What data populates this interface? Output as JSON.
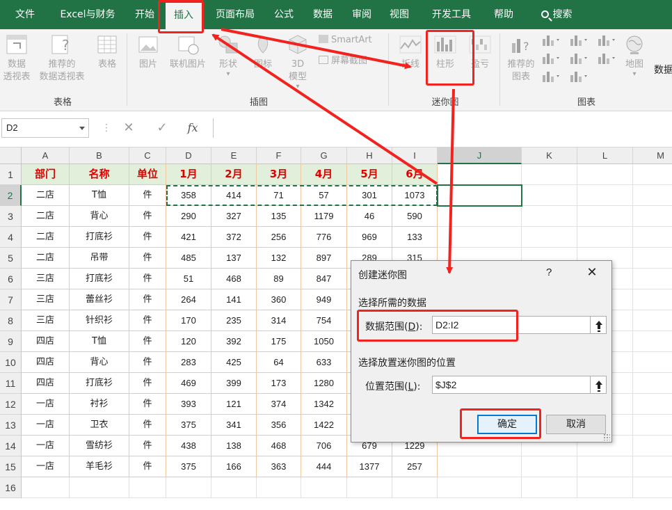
{
  "ribbon_tabs": [
    "文件",
    "Excel与财务",
    "开始",
    "插入",
    "页面布局",
    "公式",
    "数据",
    "审阅",
    "视图",
    "开发工具",
    "帮助",
    "搜索"
  ],
  "ribbon": {
    "pivot_table": [
      "数据",
      "透视表"
    ],
    "recommended_pivot": [
      "推荐的",
      "数据透视表"
    ],
    "table": "表格",
    "picture": "图片",
    "online_picture": "联机图片",
    "shapes": "形状",
    "icons": "图标",
    "model3d": [
      "3D",
      "模型"
    ],
    "smartart": "SmartArt",
    "screenshot": "屏幕截图",
    "sparkline_line": "折线",
    "sparkline_column": "柱形",
    "sparkline_winloss": "盈亏",
    "recommended_charts": [
      "推荐的",
      "图表"
    ],
    "map": "地图",
    "data_label": "数据",
    "groups": {
      "tables": "表格",
      "illustrations": "插图",
      "sparklines": "迷你图",
      "charts": "图表"
    }
  },
  "formula_bar": {
    "name_box": "D2",
    "cancel": "✕",
    "enter": "✓",
    "fx": "fx",
    "value": ""
  },
  "columns": [
    "A",
    "B",
    "C",
    "D",
    "E",
    "F",
    "G",
    "H",
    "I",
    "J",
    "K",
    "L",
    "M"
  ],
  "rows": [
    "1",
    "2",
    "3",
    "4",
    "5",
    "6",
    "7",
    "8",
    "9",
    "10",
    "11",
    "12",
    "13",
    "14",
    "15",
    "16"
  ],
  "table": {
    "headers": [
      "部门",
      "名称",
      "单位",
      "1月",
      "2月",
      "3月",
      "4月",
      "5月",
      "6月"
    ],
    "data": [
      [
        "二店",
        "T恤",
        "件",
        "358",
        "414",
        "71",
        "57",
        "301",
        "1073"
      ],
      [
        "二店",
        "背心",
        "件",
        "290",
        "327",
        "135",
        "1179",
        "46",
        "590"
      ],
      [
        "二店",
        "打底衫",
        "件",
        "421",
        "372",
        "256",
        "776",
        "969",
        "133"
      ],
      [
        "二店",
        "吊带",
        "件",
        "485",
        "137",
        "132",
        "897",
        "289",
        "315"
      ],
      [
        "三店",
        "打底衫",
        "件",
        "51",
        "468",
        "89",
        "847",
        "",
        ""
      ],
      [
        "三店",
        "蕾丝衫",
        "件",
        "264",
        "141",
        "360",
        "949",
        "",
        ""
      ],
      [
        "三店",
        "针织衫",
        "件",
        "170",
        "235",
        "314",
        "754",
        "",
        ""
      ],
      [
        "四店",
        "T恤",
        "件",
        "120",
        "392",
        "175",
        "1050",
        "",
        ""
      ],
      [
        "四店",
        "背心",
        "件",
        "283",
        "425",
        "64",
        "633",
        "",
        ""
      ],
      [
        "四店",
        "打底衫",
        "件",
        "469",
        "399",
        "173",
        "1280",
        "",
        ""
      ],
      [
        "一店",
        "衬衫",
        "件",
        "393",
        "121",
        "374",
        "1342",
        "",
        ""
      ],
      [
        "一店",
        "卫衣",
        "件",
        "375",
        "341",
        "356",
        "1422",
        "",
        ""
      ],
      [
        "一店",
        "雪纺衫",
        "件",
        "438",
        "138",
        "468",
        "706",
        "679",
        "1229"
      ],
      [
        "一店",
        "羊毛衫",
        "件",
        "375",
        "166",
        "363",
        "444",
        "1377",
        "257"
      ]
    ]
  },
  "dialog": {
    "title": "创建迷你图",
    "help": "?",
    "close": "✕",
    "section_data": "选择所需的数据",
    "data_range_label": "数据范围",
    "data_range_key": "D",
    "data_range_value": "D2:I2",
    "section_location": "选择放置迷你图的位置",
    "location_label": "位置范围",
    "location_key": "L",
    "location_value": "$J$2",
    "ok": "确定",
    "cancel": "取消"
  },
  "colors": {
    "ribbon_green": "#217346",
    "header_red": "#e00000",
    "header_fill": "#e2efda",
    "annotation_red": "#f2221e"
  }
}
